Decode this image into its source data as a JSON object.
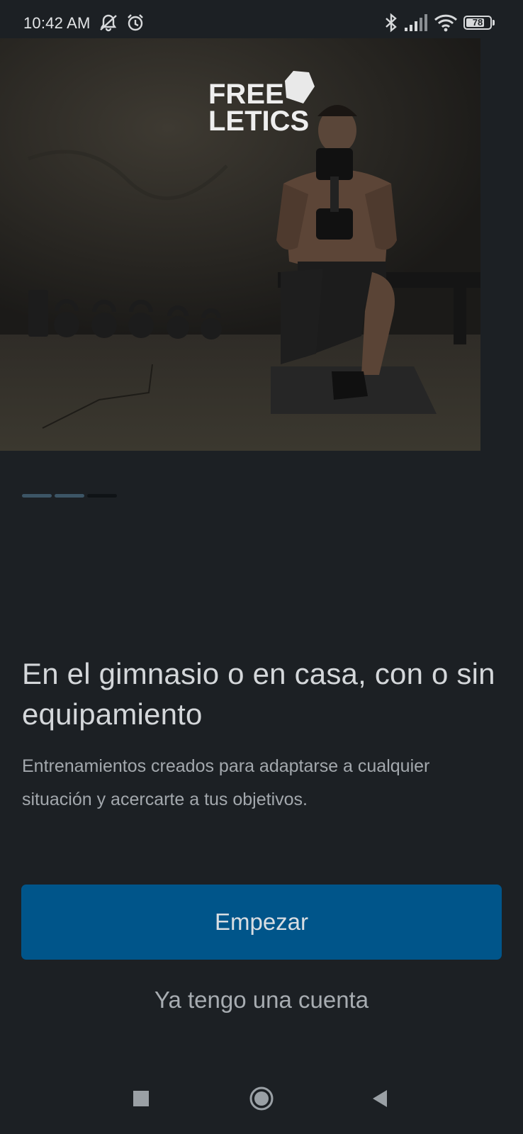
{
  "status_bar": {
    "time": "10:42 AM",
    "icons": [
      "muted-bell-icon",
      "alarm-icon",
      "bluetooth-icon",
      "signal-icon",
      "wifi-icon",
      "battery-icon"
    ],
    "battery_level": "78"
  },
  "hero": {
    "brand_logo_lines": [
      "FREE",
      "LETICS"
    ]
  },
  "pager": {
    "total": 3,
    "active_index": 1,
    "colors": {
      "active": "#3c5566",
      "inactive": "#0f1316"
    }
  },
  "onboarding": {
    "headline": "En el gimnasio o en casa, con o sin equipamiento",
    "description": "Entrenamientos creados para adaptarse a cualquier situación y acercarte a tus objetivos."
  },
  "actions": {
    "primary_label": "Empezar",
    "secondary_label": "Ya tengo una cuenta"
  },
  "nav_bar": {
    "items": [
      "recents-square-icon",
      "home-circle-icon",
      "back-triangle-icon"
    ]
  },
  "theme": {
    "background": "#1c2024",
    "primary_button": "#00558a"
  }
}
